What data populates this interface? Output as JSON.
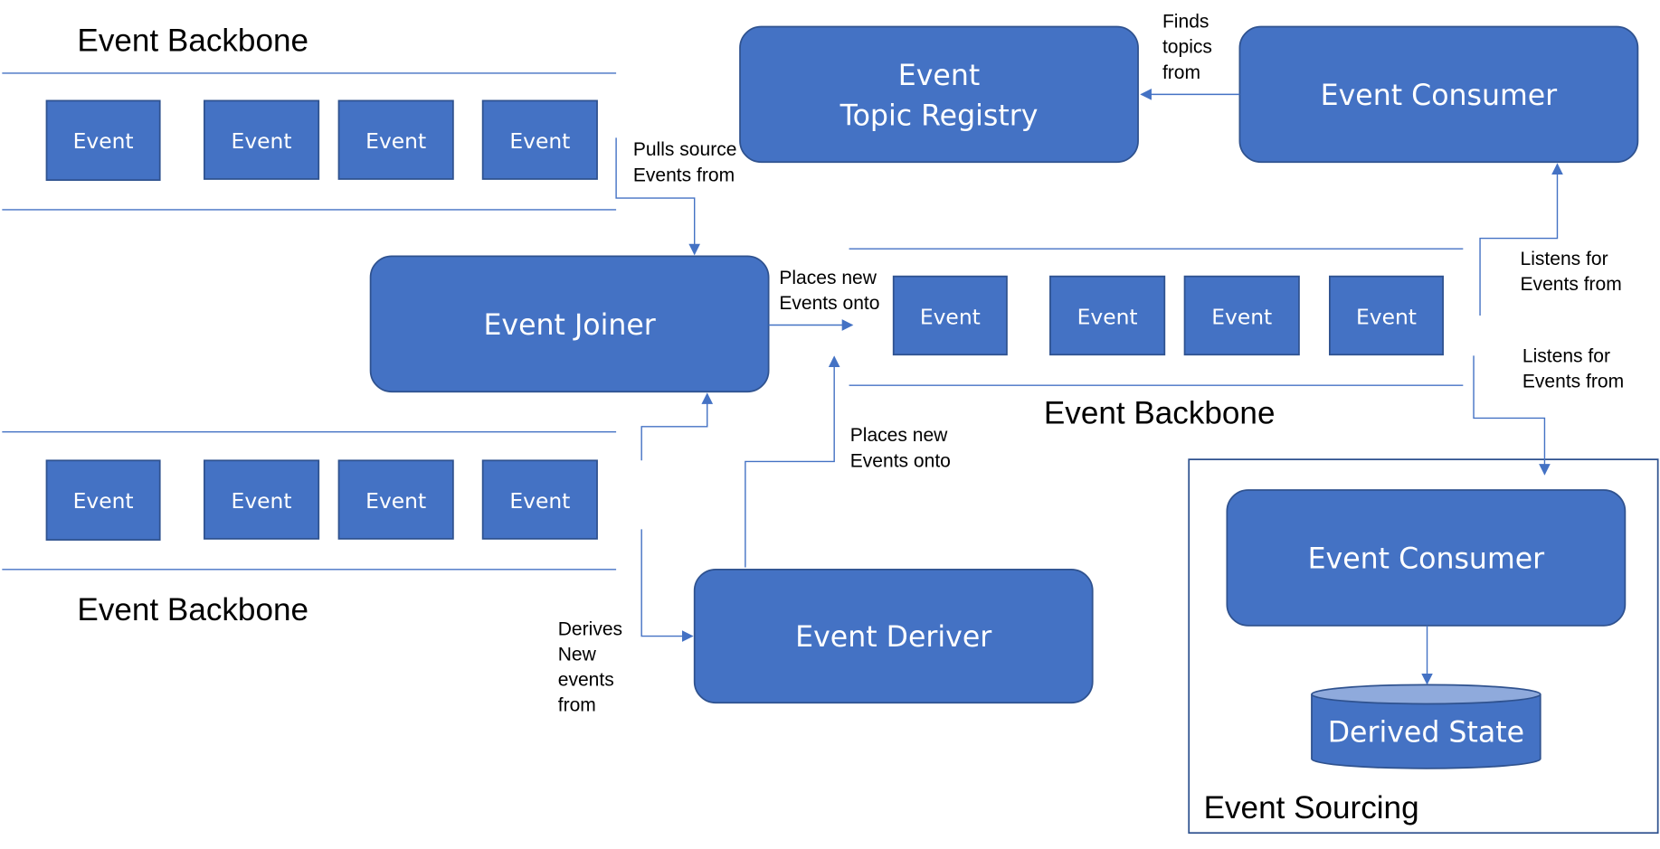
{
  "colors": {
    "node_fill": "#4472C4",
    "node_stroke": "#2F528F",
    "line": "#4472C4",
    "cylinder_top": "#8FAADC"
  },
  "backbone_top": {
    "title": "Event Backbone",
    "events": [
      "Event",
      "Event",
      "Event",
      "Event"
    ]
  },
  "backbone_bottom": {
    "title": "Event Backbone",
    "events": [
      "Event",
      "Event",
      "Event",
      "Event"
    ]
  },
  "backbone_middle": {
    "title": "Event Backbone",
    "events": [
      "Event",
      "Event",
      "Event",
      "Event"
    ]
  },
  "nodes": {
    "topic_registry": [
      "Event",
      "Topic Registry"
    ],
    "consumer_top": "Event Consumer",
    "joiner": "Event Joiner",
    "deriver": "Event Deriver",
    "consumer_sourcing": "Event Consumer",
    "derived_state": "Derived State"
  },
  "group": {
    "title": "Event Sourcing"
  },
  "labels": {
    "pulls": [
      "Pulls source",
      "Events from"
    ],
    "places1": [
      "Places new",
      "Events onto"
    ],
    "places2": [
      "Places new",
      "Events onto"
    ],
    "derives": [
      "Derives",
      "New",
      "events",
      "from"
    ],
    "finds": [
      "Finds",
      "topics",
      "from"
    ],
    "listens1": [
      "Listens for",
      "Events from"
    ],
    "listens2": [
      "Listens for",
      "Events from"
    ]
  }
}
